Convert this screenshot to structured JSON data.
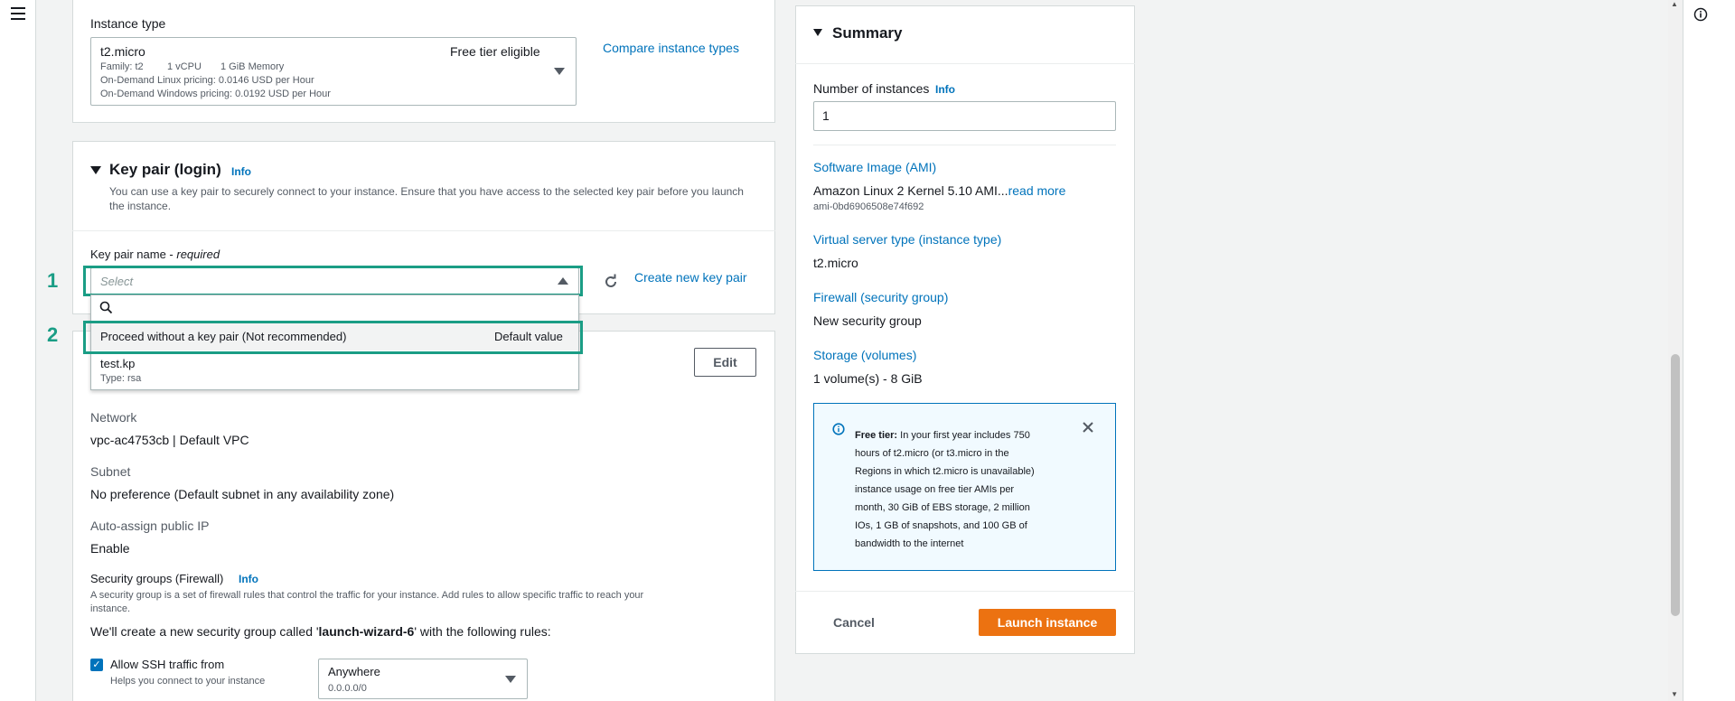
{
  "instance_type": {
    "label": "Instance type",
    "name": "t2.micro",
    "free_tier": "Free tier eligible",
    "family_line": "Family: t2",
    "vcpu": "1 vCPU",
    "memory": "1 GiB Memory",
    "linux_pricing": "On-Demand Linux pricing: 0.0146 USD per Hour",
    "windows_pricing": "On-Demand Windows pricing: 0.0192 USD per Hour",
    "compare_link": "Compare instance types"
  },
  "key_pair": {
    "title": "Key pair (login)",
    "info": "Info",
    "description_line1": "You can use a key pair to securely connect to your instance. Ensure that you have access to the selected key pair before you launch",
    "description_line2": "the instance.",
    "name_label": "Key pair name - ",
    "required": "required",
    "select_placeholder": "Select",
    "create_link": "Create new key pair",
    "options": [
      {
        "label": "Proceed without a key pair (Not recommended)",
        "tag": "Default value"
      },
      {
        "label": "test.kp",
        "sub": "Type: rsa"
      }
    ]
  },
  "annotations": {
    "step1": "1",
    "step2": "2"
  },
  "network": {
    "edit_button": "Edit",
    "network_label": "Network",
    "network_value": "vpc-ac4753cb | Default VPC",
    "subnet_label": "Subnet",
    "subnet_value": "No preference (Default subnet in any availability zone)",
    "public_ip_label": "Auto-assign public IP",
    "public_ip_value": "Enable",
    "sg_label": "Security groups (Firewall)",
    "sg_info": "Info",
    "sg_desc_line1": "A security group is a set of firewall rules that control the traffic for your instance. Add rules to allow specific traffic to reach your",
    "sg_desc_line2": "instance.",
    "sg_create_prefix": "We'll create a new security group called '",
    "sg_name": "launch-wizard-6",
    "sg_create_suffix": "' with the following rules:",
    "ssh_label": "Allow SSH traffic from",
    "ssh_help": "Helps you connect to your instance",
    "ssh_source": "Anywhere",
    "ssh_cidr": "0.0.0.0/0"
  },
  "summary": {
    "title": "Summary",
    "num_instances_label": "Number of instances",
    "num_instances_info": "Info",
    "num_instances_value": "1",
    "ami_label": "Software Image (AMI)",
    "ami_value": "Amazon Linux 2 Kernel 5.10 AMI...",
    "ami_read_more": "read more",
    "ami_id": "ami-0bd6906508e74f692",
    "server_type_label": "Virtual server type (instance type)",
    "server_type_value": "t2.micro",
    "firewall_label": "Firewall (security group)",
    "firewall_value": "New security group",
    "storage_label": "Storage (volumes)",
    "storage_value": "1 volume(s) - 8 GiB",
    "free_tier_title": "Free tier:",
    "free_tier_lines": [
      " In your first year includes 750",
      "hours of t2.micro (or t3.micro in the",
      "Regions in which t2.micro is unavailable)",
      "instance usage on free tier AMIs per",
      "month, 30 GiB of EBS storage, 2 million",
      "IOs, 1 GB of snapshots, and 100 GB of",
      "bandwidth to the internet"
    ],
    "cancel_button": "Cancel",
    "launch_button": "Launch instance"
  },
  "colors": {
    "accent": "#0073bb",
    "highlight": "#1a9d85",
    "primary_button": "#ec7211"
  },
  "icons": [
    "menu-icon",
    "info-circle-icon",
    "refresh-icon",
    "search-icon",
    "close-icon",
    "caret-down-icon",
    "caret-up-icon",
    "check-icon"
  ]
}
